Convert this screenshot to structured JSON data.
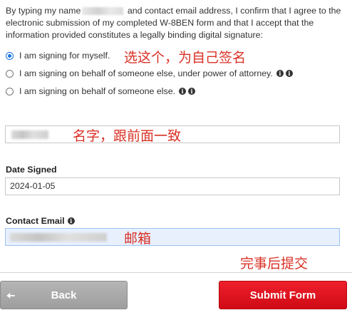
{
  "consent": {
    "text_before": "By typing my name",
    "text_after": "and contact email address, I confirm that I agree to the electronic submission of my completed W-8BEN form and that I accept that the information provided constitutes a legally binding digital signature:"
  },
  "signing_options": [
    {
      "label": "I am signing for myself.",
      "selected": true
    },
    {
      "label": "I am signing on behalf of someone else, under power of attorney.",
      "selected": false
    },
    {
      "label": "I am signing on behalf of someone else.",
      "selected": false
    }
  ],
  "annotations": {
    "choose_self": "选这个，为自己签名",
    "name_note": "名字，跟前面一致",
    "email_note": "邮箱",
    "submit_note": "完事后提交"
  },
  "fields": {
    "date_signed_label": "Date Signed",
    "date_signed_value": "2024-01-05",
    "contact_email_label": "Contact Email"
  },
  "buttons": {
    "back_label": "Back",
    "submit_label": "Submit Form"
  },
  "icons": {
    "info": "info-circle-icon",
    "back": "arrow-left-icon"
  },
  "colors": {
    "annotation": "#d93025",
    "submit": "#e3141f",
    "back": "#a8a8a8",
    "radio_selected": "#1a73e8"
  }
}
